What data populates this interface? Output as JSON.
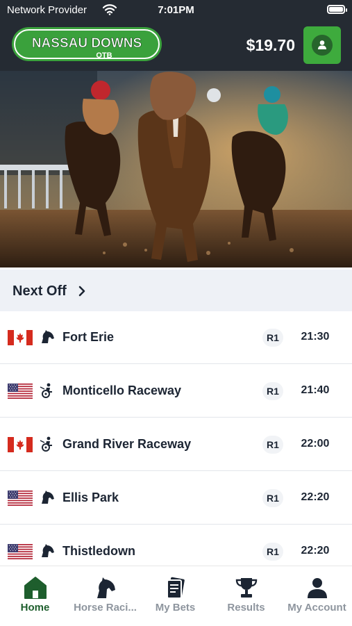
{
  "status_bar": {
    "carrier": "Network Provider",
    "time": "7:01PM"
  },
  "header": {
    "logo_text": "NASSAU DOWNS",
    "logo_sub": "OTB",
    "balance": "$19.70"
  },
  "section": {
    "title": "Next Off"
  },
  "races": [
    {
      "flag": "canada",
      "type": "horse-head-icon",
      "venue": "Fort Erie",
      "race": "R1",
      "time": "21:30"
    },
    {
      "flag": "usa",
      "type": "harness-icon",
      "venue": "Monticello Raceway",
      "race": "R1",
      "time": "21:40"
    },
    {
      "flag": "canada",
      "type": "harness-icon",
      "venue": "Grand River Raceway",
      "race": "R1",
      "time": "22:00"
    },
    {
      "flag": "usa",
      "type": "horse-head-icon",
      "venue": "Ellis Park",
      "race": "R1",
      "time": "22:20"
    },
    {
      "flag": "usa",
      "type": "horse-head-icon",
      "venue": "Thistledown",
      "race": "R1",
      "time": "22:20"
    }
  ],
  "nav": [
    {
      "label": "Home",
      "icon": "home-icon",
      "active": true
    },
    {
      "label": "Horse Raci...",
      "icon": "horse-head-icon",
      "active": false
    },
    {
      "label": "My Bets",
      "icon": "bet-slip-icon",
      "active": false
    },
    {
      "label": "Results",
      "icon": "trophy-icon",
      "active": false
    },
    {
      "label": "My Account",
      "icon": "person-icon",
      "active": false
    }
  ],
  "colors": {
    "header_bg": "#252b33",
    "brand_green": "#3eab3d",
    "dark_green": "#1e5e2d",
    "section_bg": "#eef1f6"
  }
}
